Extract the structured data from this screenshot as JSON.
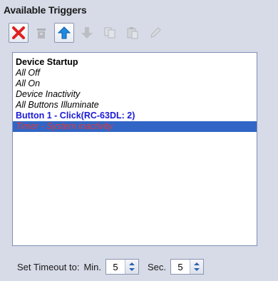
{
  "panel": {
    "title": "Available Triggers"
  },
  "toolbar": {
    "buttons": [
      {
        "icon": "delete-icon",
        "enabled": true
      },
      {
        "icon": "trash-icon",
        "enabled": false
      },
      {
        "icon": "arrow-up-icon",
        "enabled": true
      },
      {
        "icon": "arrow-down-icon",
        "enabled": false
      },
      {
        "icon": "copy-icon",
        "enabled": false
      },
      {
        "icon": "paste-icon",
        "enabled": false
      },
      {
        "icon": "edit-icon",
        "enabled": false
      }
    ]
  },
  "triggers": {
    "items": [
      {
        "label": "Device Startup"
      },
      {
        "label": "All Off"
      },
      {
        "label": "All On"
      },
      {
        "label": "Device Inactivity"
      },
      {
        "label": "All Buttons Illuminate"
      },
      {
        "label": "Button 1 - Click(RC-63DL: 2)"
      },
      {
        "label": "Timer - System inactivity",
        "selected": true
      }
    ]
  },
  "timeout": {
    "label": "Set Timeout to:",
    "min_label": "Min.",
    "min_value": "5",
    "sec_label": "Sec.",
    "sec_value": "5"
  },
  "colors": {
    "background": "#d6dbe7",
    "selection": "#3166c6",
    "selected_text": "#e23838",
    "button_text": "#1a1ad8"
  }
}
